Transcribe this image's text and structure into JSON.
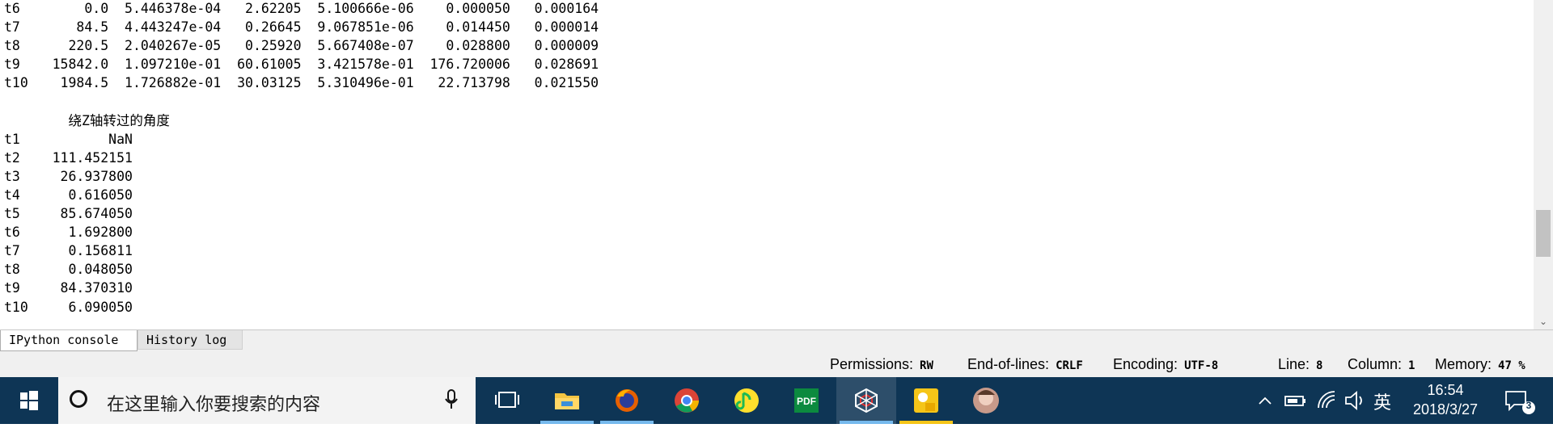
{
  "console": {
    "output": "t6        0.0  5.446378e-04   2.62205  5.100666e-06    0.000050   0.000164\nt7       84.5  4.443247e-04   0.26645  9.067851e-06    0.014450   0.000014\nt8      220.5  2.040267e-05   0.25920  5.667408e-07    0.028800   0.000009\nt9    15842.0  1.097210e-01  60.61005  3.421578e-01  176.720006   0.028691\nt10    1984.5  1.726882e-01  30.03125  5.310496e-01   22.713798   0.021550\n\n        绕Z轴转过的角度\nt1           NaN\nt2    111.452151\nt3     26.937800\nt4      0.616050\nt5     85.674050\nt6      1.692800\nt7      0.156811\nt8      0.048050\nt9     84.370310\nt10     6.090050"
  },
  "tabs": [
    {
      "label": "IPython console",
      "active": true
    },
    {
      "label": "History log",
      "active": false
    }
  ],
  "status": {
    "permissions_label": "Permissions:",
    "permissions_value": "RW",
    "eol_label": "End-of-lines:",
    "eol_value": "CRLF",
    "encoding_label": "Encoding:",
    "encoding_value": "UTF-8",
    "line_label": "Line:",
    "line_value": "8",
    "column_label": "Column:",
    "column_value": "1",
    "memory_label": "Memory:",
    "memory_value": "47 %"
  },
  "taskbar": {
    "search_placeholder": "在这里输入你要搜索的内容",
    "apps": [
      "task-view",
      "file-explorer",
      "firefox",
      "chrome",
      "qq-music",
      "pdf-app",
      "spider-app",
      "photo-viewer",
      "user-avatar"
    ],
    "input_language": "英",
    "time": "16:54",
    "date": "2018/3/27",
    "notification_count": "3"
  },
  "colors": {
    "taskbar_bg": "#0e3555",
    "active_underline": "#76b9ed",
    "status_bg": "#f0f0f0"
  }
}
